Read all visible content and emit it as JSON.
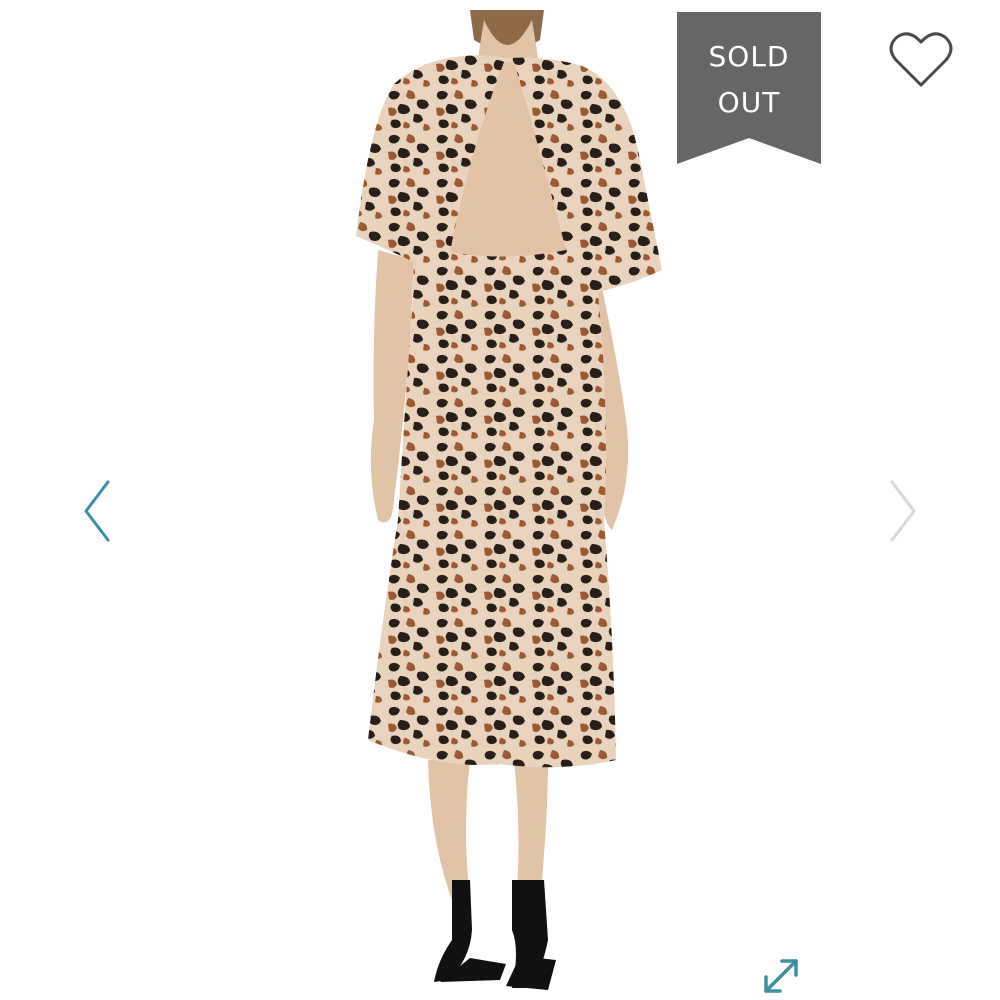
{
  "badge": {
    "line1": "SOLD",
    "line2": "OUT"
  },
  "colors": {
    "badge_bg": "#666666",
    "badge_text": "#ffffff",
    "nav_arrow_left": "#3f8fa3",
    "nav_arrow_right": "#d8d8d8",
    "expand_icon": "#3f8fa3",
    "heart_outline": "#4a4a4a",
    "print_base": "#e9d3bd",
    "print_spot": "#2a1f18",
    "print_brown": "#9a5b31",
    "skin": "#e2c3a6"
  },
  "icons": {
    "favorite": "heart-outline-icon",
    "prev": "chevron-left-icon",
    "next": "chevron-right-icon",
    "fullscreen": "expand-icon"
  }
}
